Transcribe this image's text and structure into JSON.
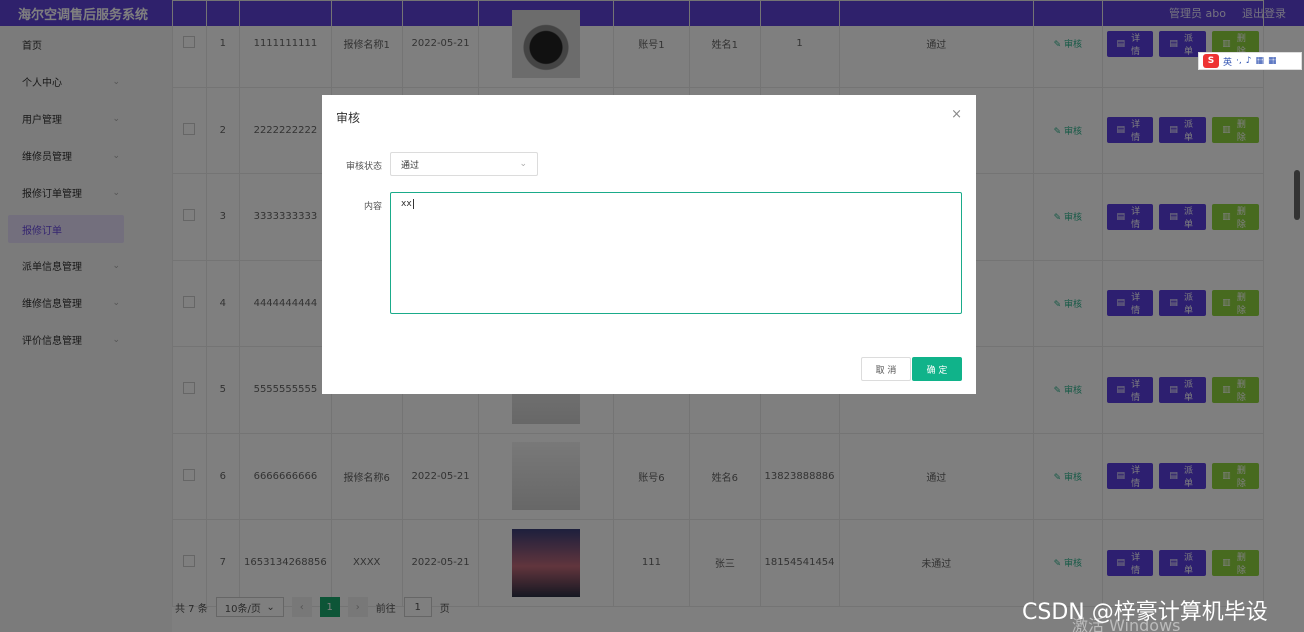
{
  "header": {
    "title": "海尔空调售后服务系统",
    "user": "管理员 abo",
    "logout": "退出登录"
  },
  "sidebar": {
    "items": [
      {
        "label": "首页",
        "chev": false
      },
      {
        "label": "个人中心",
        "chev": true
      },
      {
        "label": "用户管理",
        "chev": true
      },
      {
        "label": "维修员管理",
        "chev": true
      },
      {
        "label": "报修订单管理",
        "chev": true
      },
      {
        "label": "报修订单",
        "active": true
      },
      {
        "label": "派单信息管理",
        "chev": true
      },
      {
        "label": "维修信息管理",
        "chev": true
      },
      {
        "label": "评价信息管理",
        "chev": true
      }
    ]
  },
  "table": {
    "rows": [
      {
        "no": "1",
        "code": "1111111111",
        "name": "报修名称1",
        "date": "2022-05-21",
        "img": "wash",
        "account": "账号1",
        "uname": "姓名1",
        "phone": "1",
        "status": "通过"
      },
      {
        "no": "2",
        "code": "2222222222",
        "name": "",
        "date": "",
        "img": "photo",
        "account": "",
        "uname": "",
        "phone": "",
        "status": ""
      },
      {
        "no": "3",
        "code": "3333333333",
        "name": "",
        "date": "",
        "img": "none",
        "account": "",
        "uname": "",
        "phone": "",
        "status": ""
      },
      {
        "no": "4",
        "code": "4444444444",
        "name": "",
        "date": "",
        "img": "none",
        "account": "",
        "uname": "",
        "phone": "",
        "status": ""
      },
      {
        "no": "5",
        "code": "5555555555",
        "name": "",
        "date": "",
        "img": "ac",
        "account": "",
        "uname": "",
        "phone": "",
        "status": ""
      },
      {
        "no": "6",
        "code": "6666666666",
        "name": "报修名称6",
        "date": "2022-05-21",
        "img": "ac",
        "account": "账号6",
        "uname": "姓名6",
        "phone": "13823888886",
        "status": "通过"
      },
      {
        "no": "7",
        "code": "1653134268856",
        "name": "XXXX",
        "date": "2022-05-21",
        "img": "photo",
        "account": "111",
        "uname": "张三",
        "phone": "18154541454",
        "status": "未通过"
      }
    ]
  },
  "actions": {
    "review": "审核",
    "detail": "详情",
    "dispatch": "派单",
    "delete": "删除"
  },
  "pager": {
    "total": "共 7 条",
    "size": "10条/页",
    "current": "1",
    "goto": "前往",
    "goto_value": "1",
    "page_unit": "页"
  },
  "dialog": {
    "title": "审核",
    "status_label": "审核状态",
    "status_value": "通过",
    "content_label": "内容",
    "content_value": "xx",
    "cancel": "取 消",
    "confirm": "确 定"
  },
  "ime": {
    "lang": "英"
  },
  "watermark": "CSDN @梓豪计算机毕设",
  "activate": "激活 Windows"
}
